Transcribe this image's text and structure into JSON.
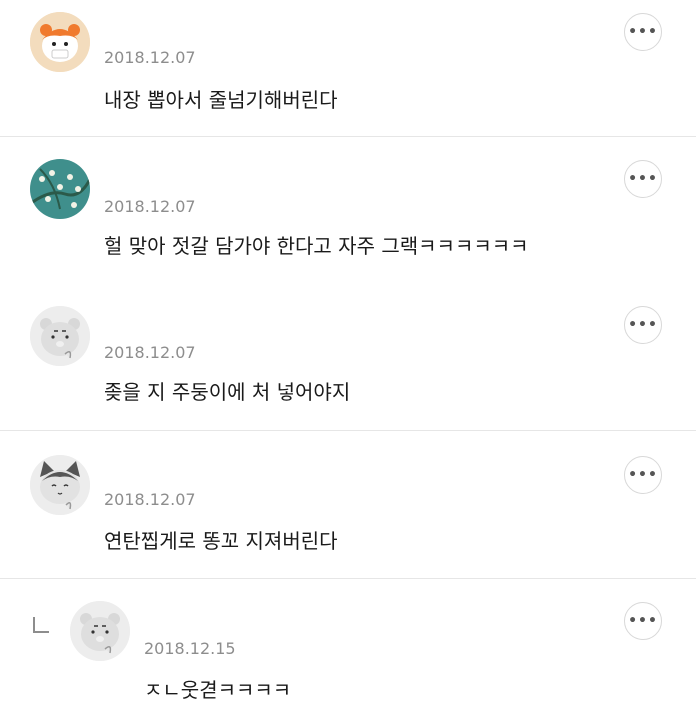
{
  "comments": [
    {
      "name": "",
      "date": "2018.12.07",
      "text": "내장 뽑아서 줄넘기해버린다",
      "more_icon": "•••"
    },
    {
      "name": "",
      "date": "2018.12.07",
      "text": "헐 맞아 젓갈 담가야 한다고 자주 그랙ㅋㅋㅋㅋㅋㅋ",
      "more_icon": "•••"
    },
    {
      "name": "",
      "date": "2018.12.07",
      "text": "좆을 지 주둥이에 처 넣어야지",
      "more_icon": "•••"
    },
    {
      "name": "",
      "date": "2018.12.07",
      "text": "연탄찝게로 똥꼬 지져버린다",
      "more_icon": "•••"
    },
    {
      "name": "",
      "date": "2018.12.15",
      "text": "ㅈㄴ웃겯ㅋㅋㅋㅋ",
      "more_icon": "•••"
    }
  ],
  "icons": {
    "more": "more-options-icon",
    "reply": "reply-arrow-icon"
  },
  "colors": {
    "divider": "#e6e6e6",
    "date": "#8d8d8d",
    "text": "#1a1a1a"
  }
}
